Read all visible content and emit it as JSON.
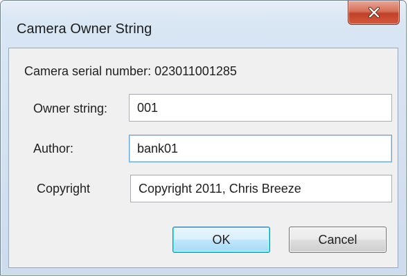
{
  "window": {
    "title": "Camera Owner String",
    "close_icon": "close-x-icon"
  },
  "serial": {
    "text": "Camera serial number: 023011001285"
  },
  "owner": {
    "label": "Owner string:",
    "value": "001"
  },
  "author": {
    "label": "Author:",
    "value": "bank01"
  },
  "copyright": {
    "label": "Copyright",
    "value": "Copyright 2011, Chris Breeze"
  },
  "buttons": {
    "ok_label": "OK",
    "cancel_label": "Cancel"
  },
  "colors": {
    "close_button": "#c7432b",
    "focus_border": "#5ea0d8",
    "dialog_background": "#f0f0f0"
  }
}
